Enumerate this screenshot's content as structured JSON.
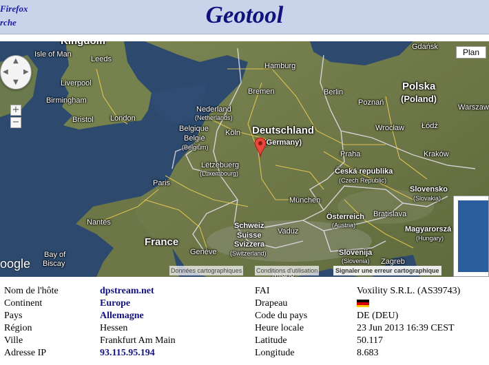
{
  "header": {
    "left_line1": "Firefox",
    "left_line2": "rche",
    "title": "Geotool"
  },
  "map": {
    "map_type_button": "Plan",
    "zoom_in": "+",
    "zoom_out": "−",
    "google_logo": "oogle",
    "footer_data": "Données cartographiques",
    "footer_terms": "Conditions d'utilisation",
    "footer_report": "Signaler une erreur cartographique",
    "labels": {
      "kingdom": "Kingdom",
      "isle_of_man": "Isle of Man",
      "leeds": "Leeds",
      "liverpool": "Liverpool",
      "birmingham": "Birmingham",
      "bristol": "Bristol",
      "london": "London",
      "paris": "Paris",
      "nantes": "Nantes",
      "france": "France",
      "bay_of": "Bay of",
      "biscay": "Biscay",
      "nederland": "Nederland",
      "netherlands": "(Netherlands)",
      "belgique": "Belgique",
      "belgie": "België",
      "belgium": "(Belgium)",
      "letzebuerg": "Lëtzebuerg",
      "luxembourg": "(Luxembourg)",
      "hamburg": "Hamburg",
      "bremen": "Bremen",
      "berlin": "Berlin",
      "koln": "Köln",
      "deutschland": "Deutschland",
      "germany": "(Germany)",
      "munchen": "München",
      "praha": "Praha",
      "ceska": "Česká republika",
      "czech": "(Czech Republic)",
      "osterreich": "Österreich",
      "austria": "(Austria)",
      "schweiz": "Schweiz",
      "suisse": "Suisse",
      "svizzera": "Svizzera",
      "switzerland": "(Switzerland)",
      "vaduz": "Vaduz",
      "geneve": "Genève",
      "slovenija": "Slovenija",
      "slovenia": "(Slovenia)",
      "zagreb": "Zagreb",
      "milano": "Milano",
      "polska": "Polska",
      "poland": "(Poland)",
      "gdansk": "Gdańsk",
      "poznan": "Poznań",
      "warszawa": "Warszaw",
      "wroclaw": "Wrocław",
      "lodz": "Łódź",
      "krakow": "Kraków",
      "slovensko": "Slovensko",
      "slovakia": "(Slovakia)",
      "bratislava": "Bratislava",
      "magyarorszag": "Magyarorszá",
      "hungary": "(Hungary)"
    },
    "marker_color": "#e8473b",
    "land_color": "#6f7a4a",
    "sea_color": "#2d4a6e"
  },
  "info": {
    "rows_left": [
      {
        "label": "Nom de l'hôte",
        "value": "dpstream.net"
      },
      {
        "label": "Continent",
        "value": "Europe"
      },
      {
        "label": "Pays",
        "value": "Allemagne"
      },
      {
        "label": "Région",
        "value": "Hessen"
      },
      {
        "label": "Ville",
        "value": "Frankfurt Am Main"
      },
      {
        "label": "Adresse IP",
        "value": "93.115.95.194"
      }
    ],
    "rows_right": [
      {
        "label": "FAI",
        "value": "Voxility S.R.L. (AS39743)"
      },
      {
        "label": "Drapeau",
        "value": "",
        "icon": "germany-flag-icon"
      },
      {
        "label": "Code du pays",
        "value": "DE (DEU)"
      },
      {
        "label": "Heure locale",
        "value": "23 Jun 2013 16:39 CEST"
      },
      {
        "label": "Latitude",
        "value": "50.117"
      },
      {
        "label": "Longitude",
        "value": "8.683"
      }
    ],
    "link_color": "#121280",
    "flag_colors": [
      "#000000",
      "#dd0000",
      "#ffce00"
    ]
  }
}
